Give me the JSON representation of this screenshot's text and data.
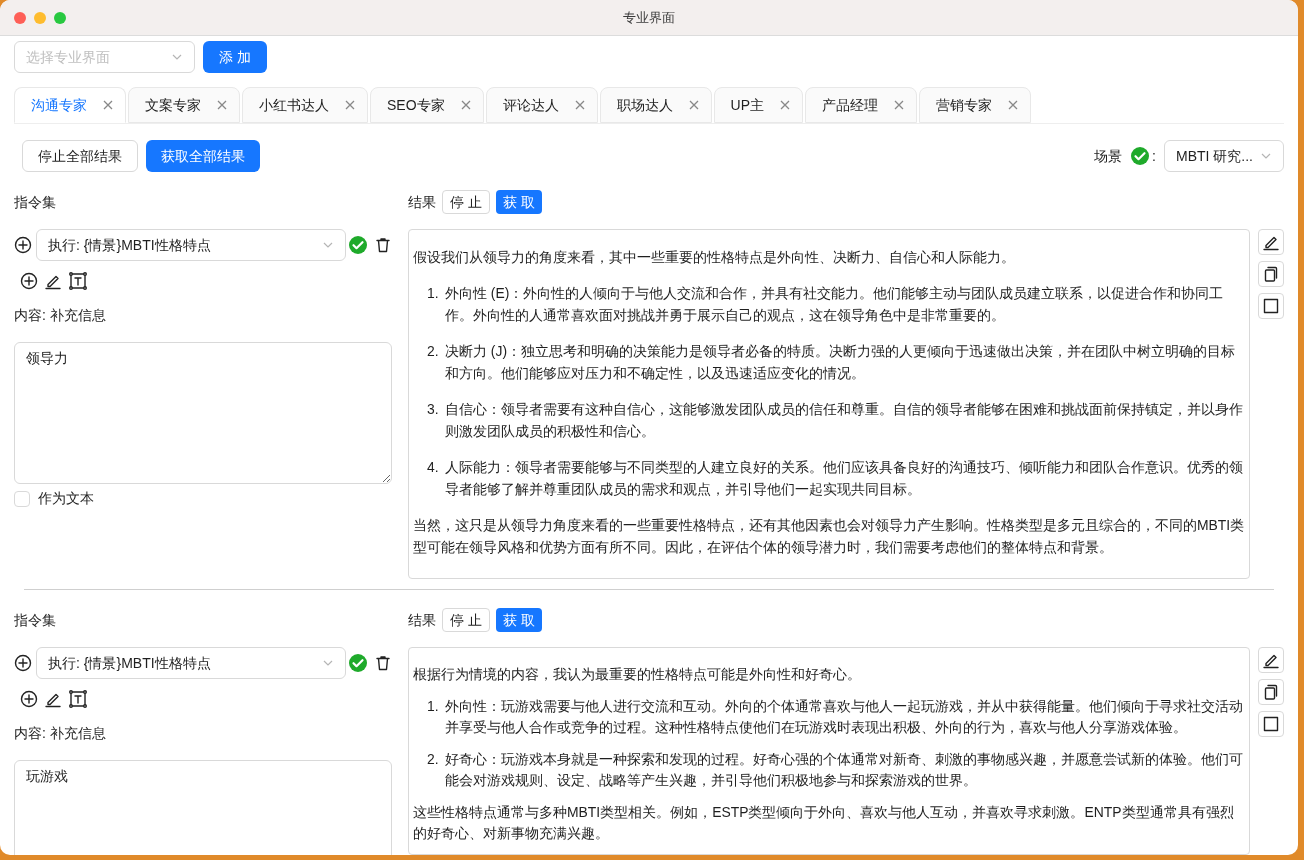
{
  "window": {
    "title": "专业界面"
  },
  "selector": {
    "placeholder": "选择专业界面",
    "add_button": "添 加"
  },
  "tabs": [
    {
      "label": "沟通专家",
      "selected": true
    },
    {
      "label": "文案专家",
      "selected": false
    },
    {
      "label": "小红书达人",
      "selected": false
    },
    {
      "label": "SEO专家",
      "selected": false
    },
    {
      "label": "评论达人",
      "selected": false
    },
    {
      "label": "职场达人",
      "selected": false
    },
    {
      "label": "UP主",
      "selected": false
    },
    {
      "label": "产品经理",
      "selected": false
    },
    {
      "label": "营销专家",
      "selected": false
    }
  ],
  "actions": {
    "stop_all": "停止全部结果",
    "fetch_all": "获取全部结果"
  },
  "scene": {
    "label": "场景",
    "ok": true,
    "colon": ":",
    "value": "MBTI 研究..."
  },
  "panels": [
    {
      "instructions_label": "指令集",
      "command": "执行: {情景}MBTI性格特点",
      "command_ok": true,
      "content_label": "内容: 补充信息",
      "content_value": "领导力",
      "as_text": {
        "label": "作为文本",
        "checked": false
      },
      "result_label": "结果",
      "stop": "停 止",
      "fetch": "获 取",
      "result": {
        "intro": "假设我们从领导力的角度来看，其中一些重要的性格特点是外向性、决断力、自信心和人际能力。",
        "items": [
          {
            "number": "1.",
            "text": "外向性 (E)：外向性的人倾向于与他人交流和合作，并具有社交能力。他们能够主动与团队成员建立联系，以促进合作和协同工作。外向性的人通常喜欢面对挑战并勇于展示自己的观点，这在领导角色中是非常重要的。"
          },
          {
            "number": "2.",
            "text": "决断力 (J)：独立思考和明确的决策能力是领导者必备的特质。决断力强的人更倾向于迅速做出决策，并在团队中树立明确的目标和方向。他们能够应对压力和不确定性，以及迅速适应变化的情况。"
          },
          {
            "number": "3.",
            "text": "自信心：领导者需要有这种自信心，这能够激发团队成员的信任和尊重。自信的领导者能够在困难和挑战面前保持镇定，并以身作则激发团队成员的积极性和信心。"
          },
          {
            "number": "4.",
            "text": "人际能力：领导者需要能够与不同类型的人建立良好的关系。他们应该具备良好的沟通技巧、倾听能力和团队合作意识。优秀的领导者能够了解并尊重团队成员的需求和观点，并引导他们一起实现共同目标。"
          }
        ],
        "outro": "当然，这只是从领导力角度来看的一些重要性格特点，还有其他因素也会对领导力产生影响。性格类型是多元且综合的，不同的MBTI类型可能在领导风格和优势方面有所不同。因此，在评估个体的领导潜力时，我们需要考虑他们的整体特点和背景。"
      }
    },
    {
      "instructions_label": "指令集",
      "command": "执行: {情景}MBTI性格特点",
      "command_ok": true,
      "content_label": "内容: 补充信息",
      "content_value": "玩游戏",
      "result_label": "结果",
      "stop": "停 止",
      "fetch": "获 取",
      "result": {
        "intro": "根据行为情境的内容，我认为最重要的性格特点可能是外向性和好奇心。",
        "items": [
          {
            "number": "1.",
            "text": "外向性：玩游戏需要与他人进行交流和互动。外向的个体通常喜欢与他人一起玩游戏，并从中获得能量。他们倾向于寻求社交活动并享受与他人合作或竞争的过程。这种性格特点使他们在玩游戏时表现出积极、外向的行为，喜欢与他人分享游戏体验。"
          },
          {
            "number": "2.",
            "text": "好奇心：玩游戏本身就是一种探索和发现的过程。好奇心强的个体通常对新奇、刺激的事物感兴趣，并愿意尝试新的体验。他们可能会对游戏规则、设定、战略等产生兴趣，并引导他们积极地参与和探索游戏的世界。"
          }
        ],
        "outro": "这些性格特点通常与多种MBTI类型相关。例如，ESTP类型倾向于外向、喜欢与他人互动，并喜欢寻求刺激。ENTP类型通常具有强烈的好奇心、对新事物充满兴趣。"
      }
    }
  ]
}
